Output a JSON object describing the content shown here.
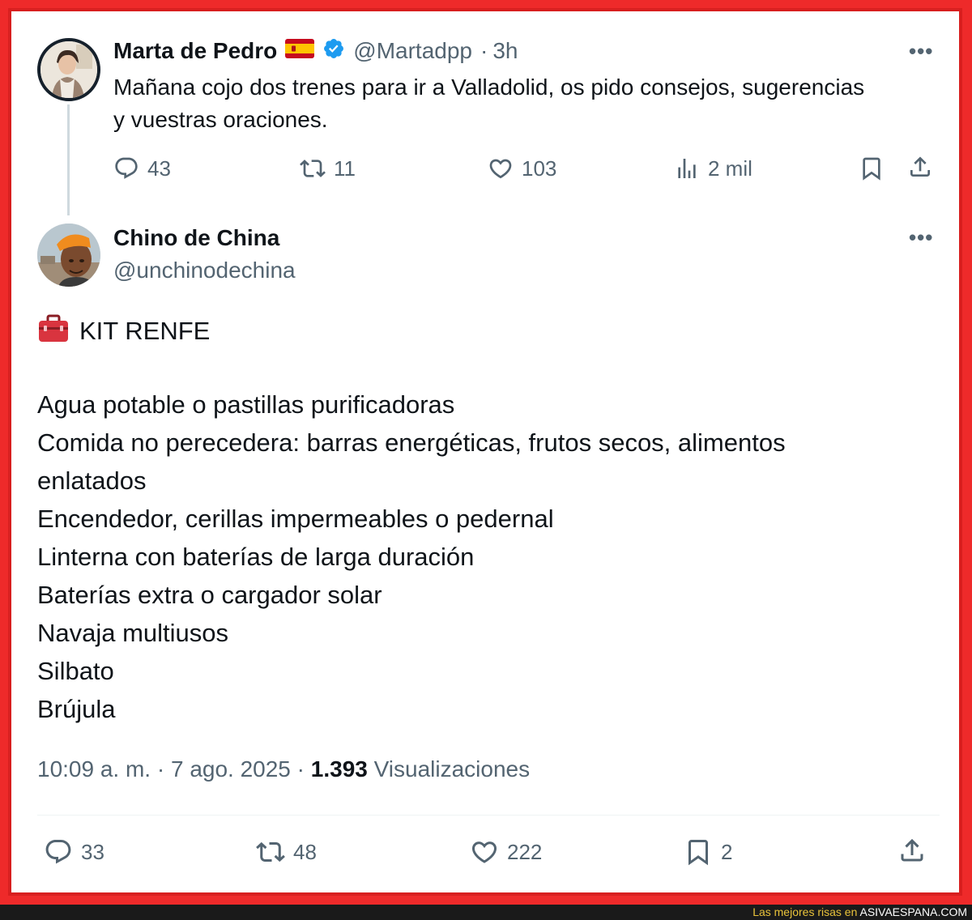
{
  "tweet1": {
    "name": "Marta de Pedro",
    "handle": "@Martadpp",
    "separator": "·",
    "time": "3h",
    "text_line1": "Mañana cojo dos trenes para ir a Valladolid, os pido consejos, sugerencias",
    "text_line2": "y vuestras oraciones.",
    "more": "•••",
    "actions": {
      "replies": "43",
      "reposts": "11",
      "likes": "103",
      "views": "2 mil"
    }
  },
  "tweet2": {
    "name": "Chino de China",
    "handle": "@unchinodechina",
    "more": "•••",
    "kit_title": "KIT RENFE",
    "items": [
      "Agua potable o pastillas purificadoras",
      "Comida no perecedera: barras energéticas, frutos secos, alimentos",
      "enlatados",
      "Encendedor, cerillas impermeables o pedernal",
      "Linterna con baterías de larga duración",
      "Baterías extra o cargador solar",
      "Navaja multiusos",
      "Silbato",
      "Brújula"
    ],
    "timestamp": "10:09 a. m. · 7 ago. 2025 · ",
    "views_count": "1.393",
    "views_label": " Visualizaciones",
    "actions": {
      "replies": "33",
      "reposts": "48",
      "likes": "222",
      "bookmarks": "2"
    }
  },
  "footer": {
    "lead": "Las mejores risas en ",
    "site": "ASIVAESPANA.COM"
  },
  "colors": {
    "frame": "#ee2a2a",
    "verified": "#1d9bf0",
    "secondary_text": "#536471"
  },
  "icons": [
    "flag-spain-icon",
    "verified-badge-icon",
    "reply-icon",
    "repost-icon",
    "like-icon",
    "views-icon",
    "bookmark-icon",
    "share-icon",
    "toolbox-icon"
  ]
}
